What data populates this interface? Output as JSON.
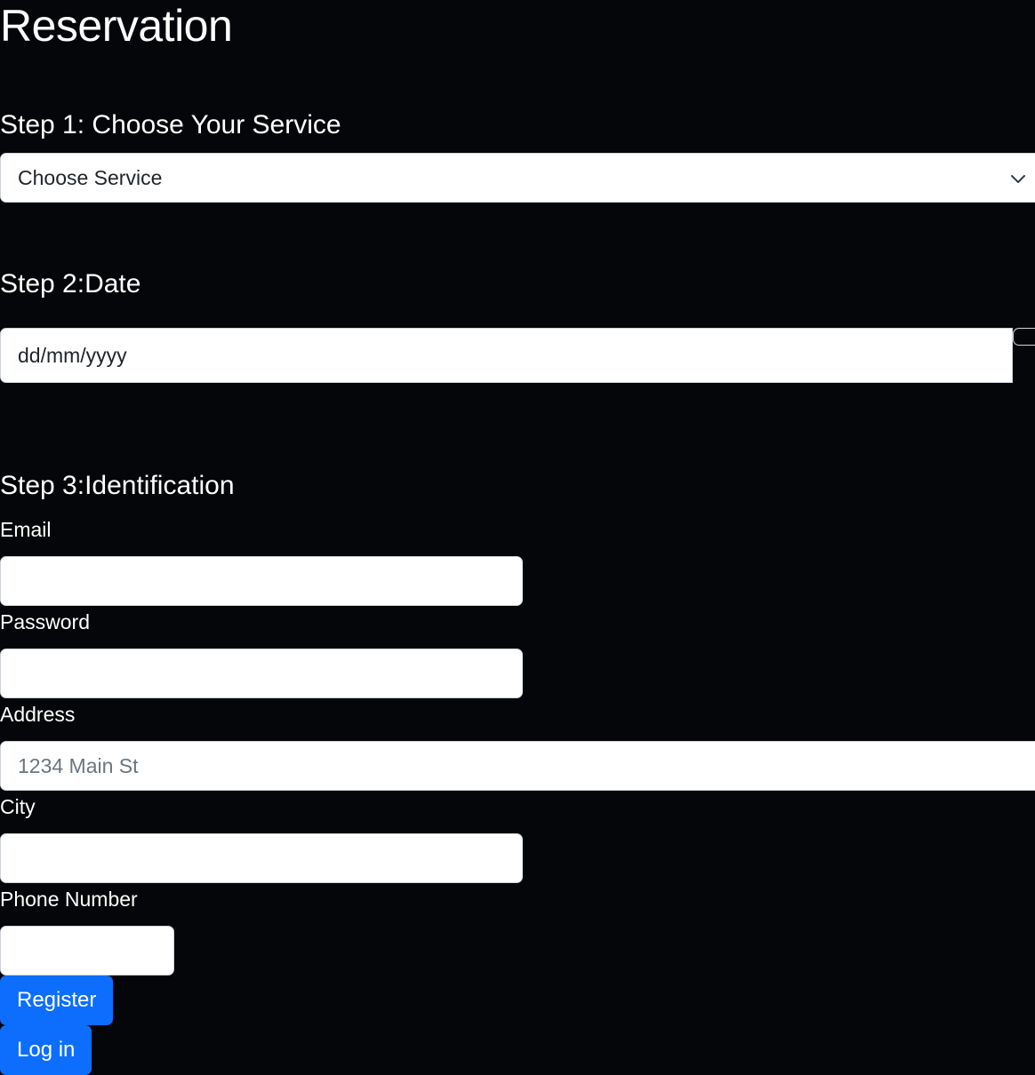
{
  "page": {
    "title": "Reservation"
  },
  "step1": {
    "heading": "Step 1: Choose Your Service",
    "select_value": "Choose Service"
  },
  "step2": {
    "heading": "Step 2:Date",
    "date_placeholder": "dd/mm/yyyy"
  },
  "step3": {
    "heading": "Step 3:Identification",
    "email_label": "Email",
    "email_value": "",
    "password_label": "Password",
    "password_value": "",
    "address_label": "Address",
    "address_placeholder": "1234 Main St",
    "city_label": "City",
    "city_value": "",
    "phone_label": "Phone Number",
    "phone_value": ""
  },
  "actions": {
    "register_label": "Register",
    "login_label": "Log in"
  },
  "colors": {
    "background": "#050609",
    "primary_button": "#0d6efd",
    "text": "#ffffff"
  },
  "icons": {
    "select_arrow": "chevron-down-icon"
  }
}
